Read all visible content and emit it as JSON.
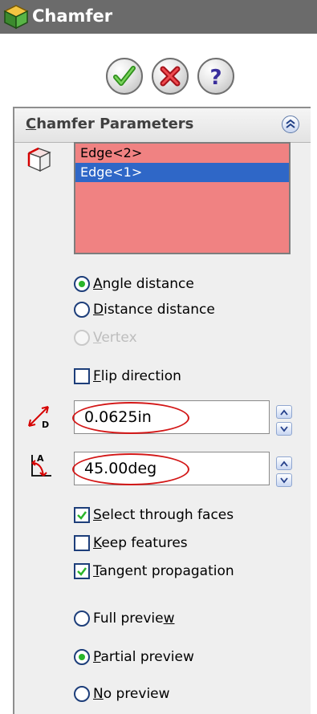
{
  "window": {
    "title": "Chamfer"
  },
  "actions": {
    "ok": "ok-icon",
    "cancel": "cancel-icon",
    "help": "help-icon"
  },
  "section": {
    "title": "Chamfer Parameters",
    "title_underline": "C",
    "title_rest": "hamfer Parameters"
  },
  "edges": {
    "items": [
      "Edge<2>",
      "Edge<1>"
    ],
    "selected_index": 1
  },
  "chamfer_type": {
    "options": [
      {
        "u": "A",
        "rest": "ngle distance",
        "label": "Angle distance",
        "selected": true,
        "enabled": true
      },
      {
        "u": "D",
        "rest": "istance distance",
        "label": "Distance distance",
        "selected": false,
        "enabled": true
      },
      {
        "u": "V",
        "rest": "ertex",
        "label": "Vertex",
        "selected": false,
        "enabled": false
      }
    ]
  },
  "flip": {
    "u": "F",
    "rest": "lip direction",
    "label": "Flip direction",
    "checked": false
  },
  "distance": {
    "value": "0.0625in"
  },
  "angle": {
    "value": "45.00deg"
  },
  "options": [
    {
      "u": "S",
      "rest": "elect through faces",
      "label": "Select through faces",
      "checked": true
    },
    {
      "u": "K",
      "rest": "eep features",
      "label": "Keep features",
      "checked": false
    },
    {
      "u": "T",
      "rest": "angent propagation",
      "label": "Tangent propagation",
      "checked": true
    }
  ],
  "preview": {
    "full": {
      "pre": "Full previe",
      "u": "w",
      "post": "",
      "label": "Full preview",
      "selected": false
    },
    "partial": {
      "pre": "",
      "u": "P",
      "post": "artial preview",
      "label": "Partial preview",
      "selected": true
    },
    "none": {
      "pre": "",
      "u": "N",
      "post": "o preview",
      "label": "No preview",
      "selected": false
    }
  },
  "colors": {
    "titlebar": "#6b6b6b",
    "list_background": "#f08282",
    "list_selection": "#2f67c7",
    "highlight_oval": "#d31717"
  }
}
